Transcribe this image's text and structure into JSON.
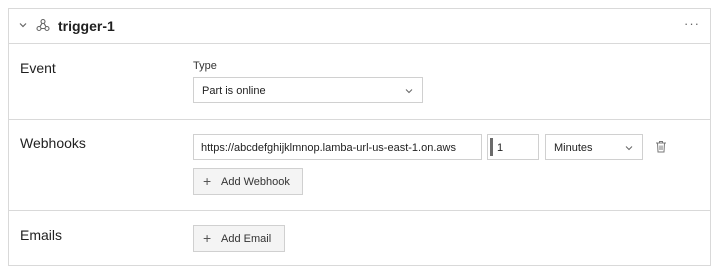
{
  "header": {
    "title": "trigger-1",
    "more_label": "···"
  },
  "event": {
    "section_label": "Event",
    "type_label": "Type",
    "type_value": "Part is online"
  },
  "webhooks": {
    "section_label": "Webhooks",
    "url_value": "https://abcdefghijklmnop.lamba-url-us-east-1.on.aws",
    "interval_value": "1",
    "unit_value": "Minutes",
    "add_label": "Add Webhook"
  },
  "emails": {
    "section_label": "Emails",
    "add_label": "Add Email"
  },
  "icons": {
    "collapse": "chevron-down-icon",
    "trigger": "webhook-icon",
    "more": "more-horizontal-icon",
    "select_caret": "chevron-down-icon",
    "delete": "trash-icon",
    "add": "plus-icon"
  }
}
